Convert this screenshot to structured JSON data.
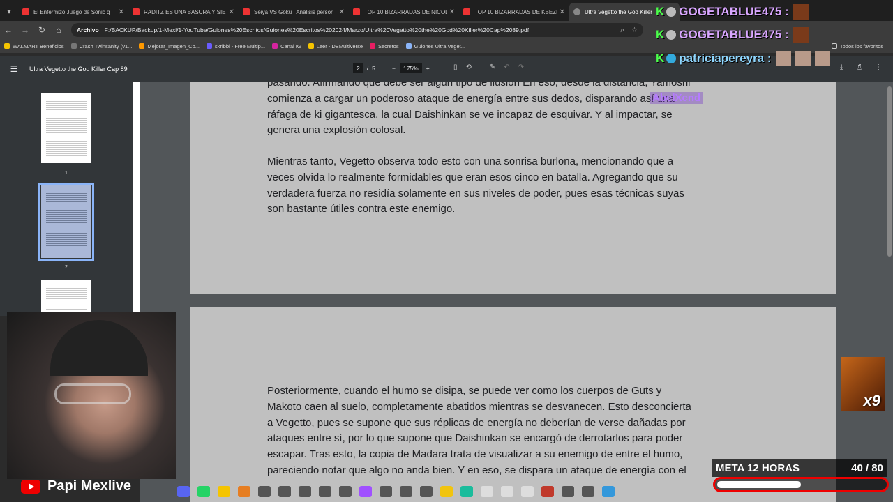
{
  "browser": {
    "tabs": [
      {
        "title": "El Enfermizo Juego de Sonic q",
        "active": false
      },
      {
        "title": "RADITZ ES UNA BASURA Y SIE",
        "active": false
      },
      {
        "title": "Seiya VS Goku | Análisis persor",
        "active": false
      },
      {
        "title": "TOP 10 BIZARRADAS DE NICOL",
        "active": false
      },
      {
        "title": "TOP 10 BIZARRADAS DE KBEZL",
        "active": false
      },
      {
        "title": "Ultra Vegetto the God Killer",
        "active": true
      }
    ],
    "address_chip": "Archivo",
    "url": "F:/BACKUP/Backup/1-Mexi/1-YouTube/Guiones%20Escritos/Guiones%20Escritos%202024/Marzo/Ultra%20Vegetto%20the%20God%20Killer%20Cap%2089.pdf",
    "bookmarks": [
      {
        "label": "WALMART Beneficios",
        "color": "#f5c400"
      },
      {
        "label": "Crash Twinsanity (v1...",
        "color": "#777"
      },
      {
        "label": "Mejorar_Imagen_Co...",
        "color": "#f90"
      },
      {
        "label": "skribbl - Free Multip...",
        "color": "#6a5cff"
      },
      {
        "label": "Canal IG",
        "color": "#d6249f"
      },
      {
        "label": "Leer - DBMultiverse",
        "color": "#f5c400"
      },
      {
        "label": "Secretos",
        "color": "#e91e63"
      },
      {
        "label": "Guiones Ultra Veget...",
        "color": "#8ab4f8"
      }
    ],
    "all_bookmarks": "Todos los favoritos"
  },
  "pdf": {
    "title": "Ultra Vegetto the God Killer Cap 89",
    "current_page": "2",
    "page_separator": "/",
    "total_pages": "5",
    "zoom_out": "−",
    "zoom": "175%",
    "zoom_in": "+",
    "thumbnails": [
      {
        "num": "1",
        "selected": false
      },
      {
        "num": "2",
        "selected": true
      },
      {
        "num": "",
        "selected": false
      }
    ],
    "page_a_lines": [
      "pasando. Afirmando que debe ser algún tipo de ilusión En eso, desde la distancia, Yamoshi",
      "comienza a cargar un poderoso ataque de energía entre sus dedos, disparando así una",
      "ráfaga de ki gigantesca, la cual Daishinkan se ve incapaz de esquivar. Y al impactar, se",
      "genera una explosión colosal."
    ],
    "page_a_para2": [
      "Mientras tanto, Vegetto observa todo esto con una sonrisa burlona, mencionando que a",
      "veces olvida lo realmente formidables que eran esos cinco en batalla. Agregando que su",
      "verdadera fuerza no residía solamente en sus niveles de poder, pues esas técnicas suyas",
      "son bastante útiles contra este enemigo."
    ],
    "page_b_lines": [
      "Posteriormente, cuando el humo se disipa, se puede ver como los cuerpos de Guts y",
      "Makoto caen al suelo, completamente abatidos mientras se desvanecen. Esto desconcierta",
      "a Vegetto, pues se supone que sus réplicas de energía no deberían de verse dañadas por",
      "ataques entre sí, por lo que supone que Daishinkan se encargó de derrotarlos para poder",
      "escapar. Tras esto, la copia de Madara trata de visualizar a su enemigo de entre el humo,",
      "pareciendo notar que algo no anda bien. Y en eso, se dispara un ataque de energía con el"
    ]
  },
  "stream": {
    "chat": [
      {
        "user": "GOGETABLUE475 :",
        "style": "purple"
      },
      {
        "user": "GOGETABLUE475 :",
        "style": "purple"
      },
      {
        "user": "patriciapereyra :",
        "style": "blue"
      }
    ],
    "overlay_name": "AbelXcnd",
    "gift_multiplier": "x9",
    "goal_label": "META 12 HORAS",
    "goal_value": "40 / 80",
    "goal_progress": 0.5,
    "streamer_name": "Papi Mexlive"
  }
}
